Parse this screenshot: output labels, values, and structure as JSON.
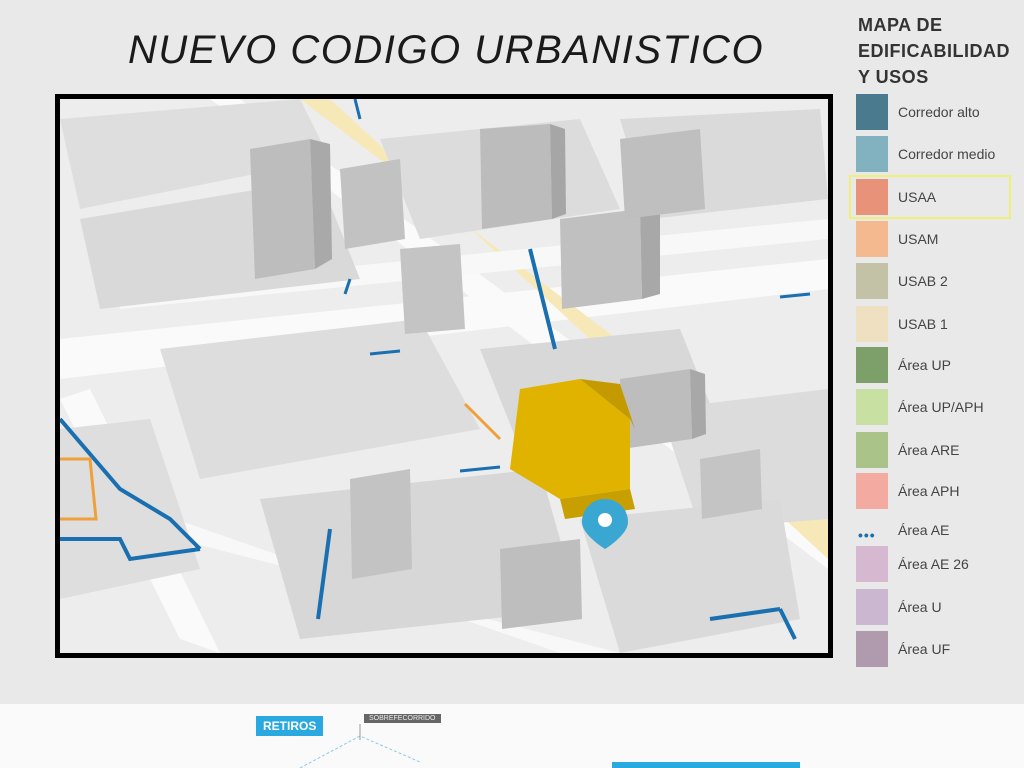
{
  "title": "NUEVO CODIGO URBANISTICO",
  "legend": {
    "title_lines": [
      "MAPA DE",
      "EDIFICABILIDAD",
      "Y USOS"
    ],
    "items": [
      {
        "label": "Corredor alto",
        "color": "#4a7a8e",
        "style": "swatch"
      },
      {
        "label": "Corredor medio",
        "color": "#82b2c0",
        "style": "swatch"
      },
      {
        "label": "USAA",
        "color": "#e8927a",
        "style": "swatch",
        "highlighted": true
      },
      {
        "label": "USAM",
        "color": "#f4b98e",
        "style": "swatch"
      },
      {
        "label": "USAB 2",
        "color": "#c3c1a6",
        "style": "swatch"
      },
      {
        "label": "USAB 1",
        "color": "#eee0c0",
        "style": "swatch"
      },
      {
        "label": "Área UP",
        "color": "#7da06a",
        "style": "swatch"
      },
      {
        "label": "Área UP/APH",
        "color": "#c8e1a2",
        "style": "swatch"
      },
      {
        "label": "Área ARE",
        "color": "#a9c389",
        "style": "swatch"
      },
      {
        "label": "Área APH",
        "color": "#f3aaa0",
        "style": "swatch"
      },
      {
        "label": "Área AE",
        "color": "#1a6fb0",
        "style": "dots"
      },
      {
        "label": "Área AE 26",
        "color": "#d6b9d1",
        "style": "swatch"
      },
      {
        "label": "Área U",
        "color": "#cbb7cf",
        "style": "swatch"
      },
      {
        "label": "Área UF",
        "color": "#b09aae",
        "style": "swatch"
      }
    ]
  },
  "bottom": {
    "retiros_label": "RETIROS",
    "small_tag": "SOBREFECORRIDO"
  },
  "map": {
    "pin_icon": "location-pin-icon",
    "highlight_color": "#e0b300",
    "pin_color": "#3aa7d2"
  }
}
